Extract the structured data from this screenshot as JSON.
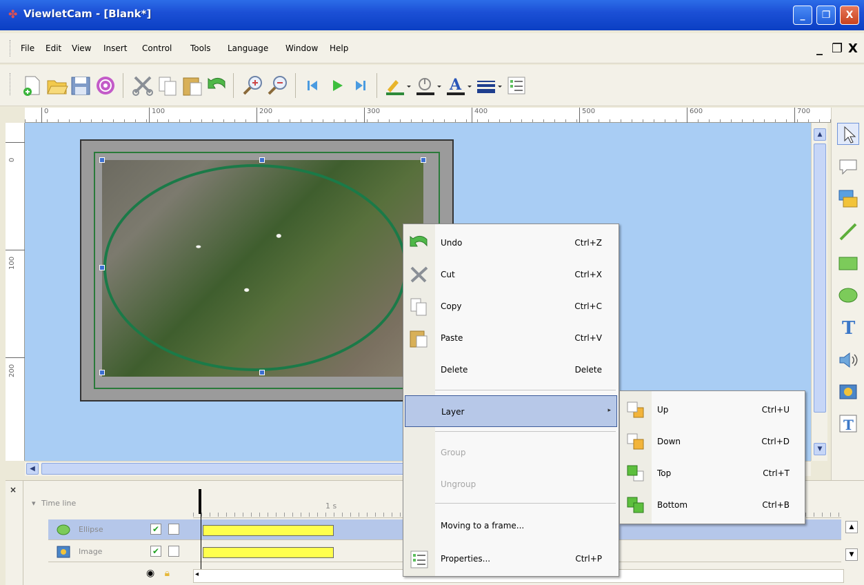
{
  "window": {
    "title": "ViewletCam - [Blank*]",
    "minimize_label": "_",
    "restore_label": "❐",
    "close_label": "X"
  },
  "menubar": {
    "items": [
      "File",
      "Edit",
      "View",
      "Insert",
      "Control",
      "Tools",
      "Language",
      "Window",
      "Help"
    ],
    "mdi_min": "_",
    "mdi_restore": "❐",
    "mdi_close": "X"
  },
  "toolbar": {
    "icons": [
      "new-icon",
      "open-icon",
      "save-icon",
      "record-icon",
      "cut-icon",
      "copy-icon",
      "paste-icon",
      "undo-icon",
      "zoom-in-icon",
      "zoom-out-icon",
      "first-frame-icon",
      "play-icon",
      "last-frame-icon",
      "line-color-icon",
      "fill-color-icon",
      "font-color-icon",
      "line-width-icon",
      "properties-icon"
    ]
  },
  "ruler": {
    "h_labels": [
      "0",
      "100",
      "200",
      "300",
      "400",
      "500",
      "600",
      "700"
    ],
    "v_labels": [
      "0",
      "100",
      "200"
    ]
  },
  "palette": {
    "tools": [
      "select-icon",
      "callout-icon",
      "image-swap-icon",
      "line-icon",
      "rectangle-icon",
      "ellipse-icon",
      "text-icon",
      "sound-icon",
      "image-icon",
      "text-box-icon"
    ]
  },
  "timeline": {
    "header": "Time line",
    "second_mark": "1 s",
    "rows": [
      {
        "name": "Ellipse",
        "visible": true,
        "locked": false,
        "selected": true
      },
      {
        "name": "Image",
        "visible": true,
        "locked": false,
        "selected": false
      }
    ]
  },
  "context_menu": {
    "items": [
      {
        "label": "Undo",
        "shortcut": "Ctrl+Z",
        "icon": "undo-icon",
        "disabled": false
      },
      {
        "label": "Cut",
        "shortcut": "Ctrl+X",
        "icon": "cut-icon",
        "disabled": false
      },
      {
        "label": "Copy",
        "shortcut": "Ctrl+C",
        "icon": "copy-icon",
        "disabled": false
      },
      {
        "label": "Paste",
        "shortcut": "Ctrl+V",
        "icon": "paste-icon",
        "disabled": false
      },
      {
        "label": "Delete",
        "shortcut": "Delete",
        "icon": "",
        "disabled": false
      },
      {
        "label": "Layer",
        "shortcut": "",
        "icon": "",
        "disabled": false,
        "submenu": true
      },
      {
        "label": "Group",
        "shortcut": "",
        "icon": "",
        "disabled": true
      },
      {
        "label": "Ungroup",
        "shortcut": "",
        "icon": "",
        "disabled": true
      },
      {
        "label": "Moving to a frame...",
        "shortcut": "",
        "icon": "",
        "disabled": false
      },
      {
        "label": "Properties...",
        "shortcut": "Ctrl+P",
        "icon": "properties-icon",
        "disabled": false
      }
    ]
  },
  "layer_submenu": {
    "items": [
      {
        "label": "Up",
        "shortcut": "Ctrl+U",
        "icon": "layer-up-icon"
      },
      {
        "label": "Down",
        "shortcut": "Ctrl+D",
        "icon": "layer-down-icon"
      },
      {
        "label": "Top",
        "shortcut": "Ctrl+T",
        "icon": "layer-top-icon"
      },
      {
        "label": "Bottom",
        "shortcut": "Ctrl+B",
        "icon": "layer-bottom-icon"
      }
    ]
  },
  "colors": {
    "canvas_bg": "#A9CDF4",
    "timeline_bar": "#FFFF4E",
    "menu_highlight": "#B7C8E8",
    "titlebar": "#1C50D6"
  }
}
